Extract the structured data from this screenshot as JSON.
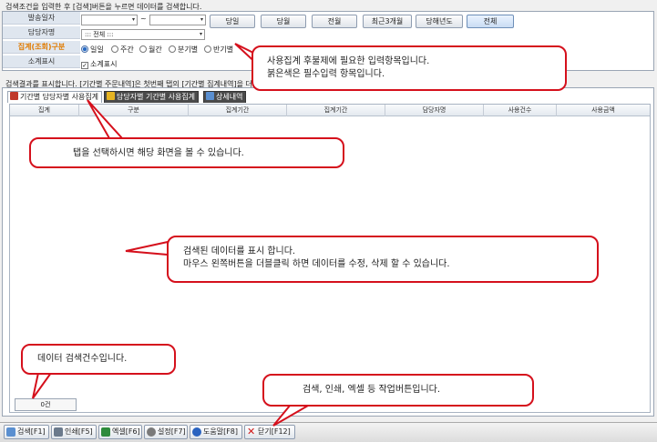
{
  "search": {
    "hint": "검색조건을 입력한 후 [검색]버튼을 누르면 데이터를 검색합니다.",
    "labels": {
      "date": "발송일자",
      "manager": "담당자명",
      "group": "집계(조회)구분",
      "subtotal": "소계표시"
    },
    "date_sep": "~",
    "period_buttons": [
      "당일",
      "당월",
      "전월",
      "최근3개월",
      "당해년도",
      "전체"
    ],
    "active_period": "전체",
    "manager_value": "::: 전체 :::",
    "group_options": [
      "일일",
      "주간",
      "월간",
      "분기별",
      "반기별"
    ],
    "selected_group": "일일",
    "subtotal_label": "소계표시",
    "subtotal_checked": true
  },
  "result": {
    "hint": "검색결과를 표시합니다. [기간별 주문내역]은 첫번째 탭의 [기간별 집계내역]을 더",
    "tabs": [
      {
        "label": "기간별 담당자별 사용집계",
        "active": true
      },
      {
        "label": "담당자별 기간별 사용집계",
        "active": false
      },
      {
        "label": "상세내역",
        "active": false
      }
    ],
    "columns": [
      "집계",
      "구분",
      "집계기간",
      "집계기간",
      "담당자명",
      "사용건수",
      "사용금액"
    ],
    "count": "0건"
  },
  "toolbar": [
    {
      "label": "검색[F1]",
      "icon": "search-icon",
      "color": "#5a8fd0"
    },
    {
      "label": "인쇄[F5]",
      "icon": "print-icon",
      "color": "#6b7a8c"
    },
    {
      "label": "엑셀[F6]",
      "icon": "excel-icon",
      "color": "#2e8b3c"
    },
    {
      "label": "설정[F7]",
      "icon": "settings-icon",
      "color": "#7a7a7a"
    },
    {
      "label": "도움말[F8]",
      "icon": "help-icon",
      "color": "#2a63c0"
    },
    {
      "label": "닫기[F12]",
      "icon": "close-icon",
      "color": "#d01818"
    }
  ],
  "callouts": {
    "c1_line1": "사용집계 후불제에  필요한 입력항목입니다.",
    "c1_line2": "붉은색은 필수입력 항목입니다.",
    "c2": "탭을 선택하시면 해당 화면을 볼 수 있습니다.",
    "c3_line1": "검색된 데이터를 표시 합니다.",
    "c3_line2": "마우스 왼쪽버튼을 더블클릭 하면 데이터를 수정, 삭제 할 수 있습니다.",
    "c4": "데이터 검색건수입니다.",
    "c5": "검색, 인쇄, 엑셀  등 작업버튼입니다."
  },
  "colors": {
    "callout_border": "#d5101c",
    "required_label": "#e07b00",
    "header_bg": "#dfe6ef"
  }
}
